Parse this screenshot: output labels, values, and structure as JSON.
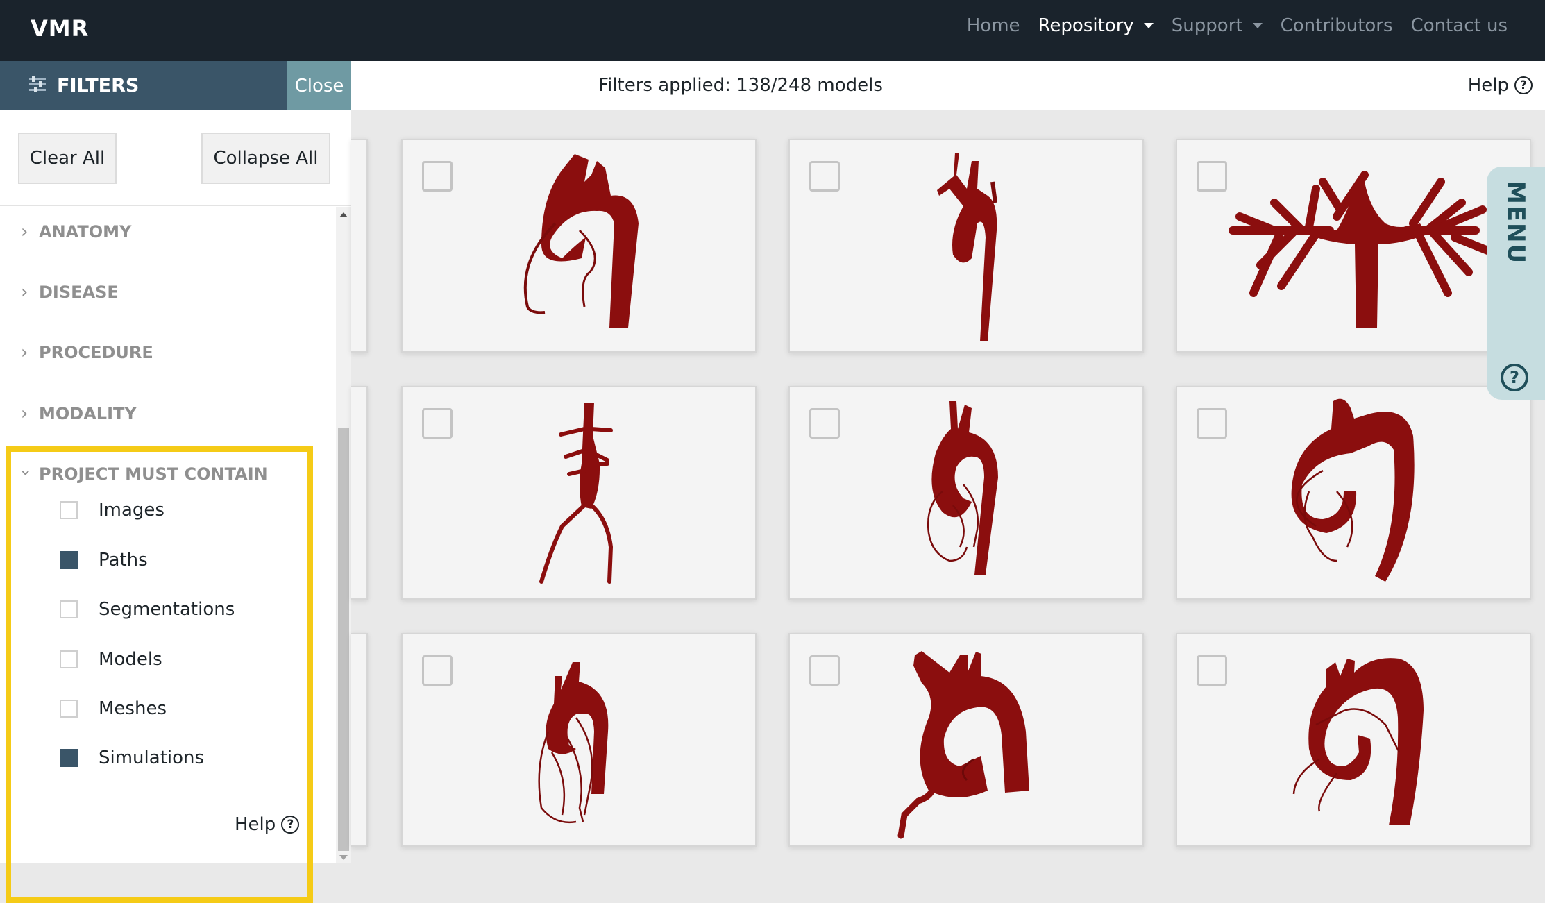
{
  "nav": {
    "brand": "VMR",
    "links": [
      {
        "label": "Home"
      },
      {
        "label": "Repository"
      },
      {
        "label": "Support"
      },
      {
        "label": "Contributors"
      },
      {
        "label": "Contact us"
      }
    ]
  },
  "filters": {
    "title": "FILTERS",
    "close_label": "Close",
    "clear_all_label": "Clear All",
    "collapse_all_label": "Collapse All",
    "categories": [
      {
        "label": "ANATOMY",
        "expanded": false
      },
      {
        "label": "DISEASE",
        "expanded": false
      },
      {
        "label": "PROCEDURE",
        "expanded": false
      },
      {
        "label": "MODALITY",
        "expanded": false
      },
      {
        "label": "PROJECT MUST CONTAIN",
        "expanded": true
      }
    ],
    "must_contain_options": [
      {
        "label": "Images",
        "checked": false
      },
      {
        "label": "Paths",
        "checked": true
      },
      {
        "label": "Segmentations",
        "checked": false
      },
      {
        "label": "Models",
        "checked": false
      },
      {
        "label": "Meshes",
        "checked": false
      },
      {
        "label": "Simulations",
        "checked": true
      }
    ],
    "help_label": "Help"
  },
  "status": {
    "text": "Filters applied: 138/248 models",
    "help_label": "Help"
  },
  "menu_tab": {
    "label": "MENU"
  },
  "colors": {
    "nav_bg": "#1a232c",
    "filters_header": "#3a5568",
    "close_button": "#6f9aa3",
    "checkbox_checked": "#3a5568",
    "highlight": "#f5cb17",
    "model_red": "#8b0e0e",
    "menu_tab": "#c6dde0"
  }
}
